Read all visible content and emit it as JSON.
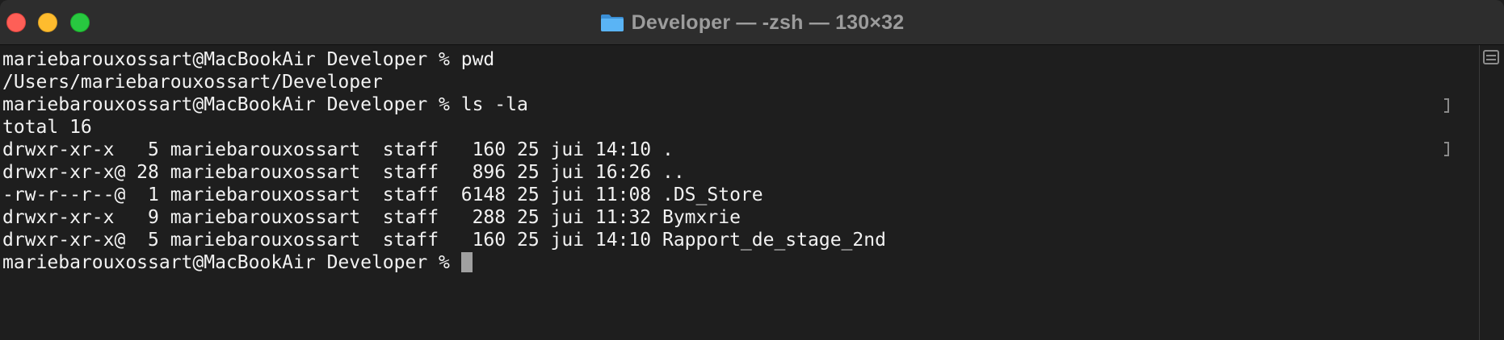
{
  "window": {
    "title": "Developer — -zsh — 130×32"
  },
  "terminal": {
    "lines": [
      "mariebarouxossart@MacBookAir Developer % pwd",
      "/Users/mariebarouxossart/Developer",
      "mariebarouxossart@MacBookAir Developer % ls -la",
      "total 16",
      "drwxr-xr-x   5 mariebarouxossart  staff   160 25 jui 14:10 .",
      "drwxr-xr-x@ 28 mariebarouxossart  staff   896 25 jui 16:26 ..",
      "-rw-r--r--@  1 mariebarouxossart  staff  6148 25 jui 11:08 .DS_Store",
      "drwxr-xr-x   9 mariebarouxossart  staff   288 25 jui 11:32 Bymxrie",
      "drwxr-xr-x@  5 mariebarouxossart  staff   160 25 jui 14:10 Rapport_de_stage_2nd"
    ],
    "prompt": "mariebarouxossart@MacBookAir Developer % "
  },
  "colors": {
    "background": "#1e1e1e",
    "titlebar": "#2d2d2d",
    "text": "#f2f2f2",
    "close": "#fe5f57",
    "minimize": "#febc2e",
    "zoom": "#28c840",
    "folder": "#4aa7f0"
  },
  "icons": {
    "title": "folder-icon",
    "sidebar": "sidebar-toggle-icon"
  }
}
